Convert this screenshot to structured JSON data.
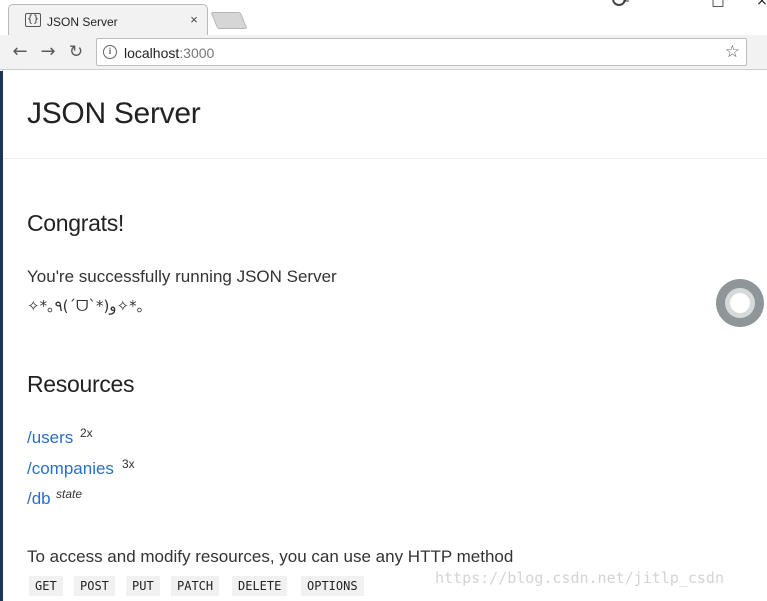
{
  "browser": {
    "tab_title": "JSON Server",
    "tab_close": "×",
    "url_host": "localhost",
    "url_port": ":3000",
    "icons": {
      "back": "arrow-left",
      "forward": "arrow-right",
      "reload": "reload",
      "info": "info",
      "bookmark": "star"
    }
  },
  "page": {
    "title": "JSON Server",
    "congrats_heading": "Congrats!",
    "running_text": "You're successfully running JSON Server",
    "kaomoji": "✧*｡٩(ˊᗜˋ*)و✧*｡",
    "resources_heading": "Resources",
    "resources": [
      {
        "path": "/users",
        "note": "2x"
      },
      {
        "path": "/companies",
        "note": "3x"
      },
      {
        "path": "/db",
        "note": "state"
      }
    ],
    "access_text": "To access and modify resources, you can use any HTTP method",
    "methods": [
      "GET",
      "POST",
      "PUT",
      "PATCH",
      "DELETE",
      "OPTIONS"
    ]
  },
  "watermark": "https://blog.csdn.net/jitlp_csdn",
  "colors": {
    "link": "#2a6fc4",
    "text": "#333333",
    "code_bg": "#f1f1f1"
  }
}
